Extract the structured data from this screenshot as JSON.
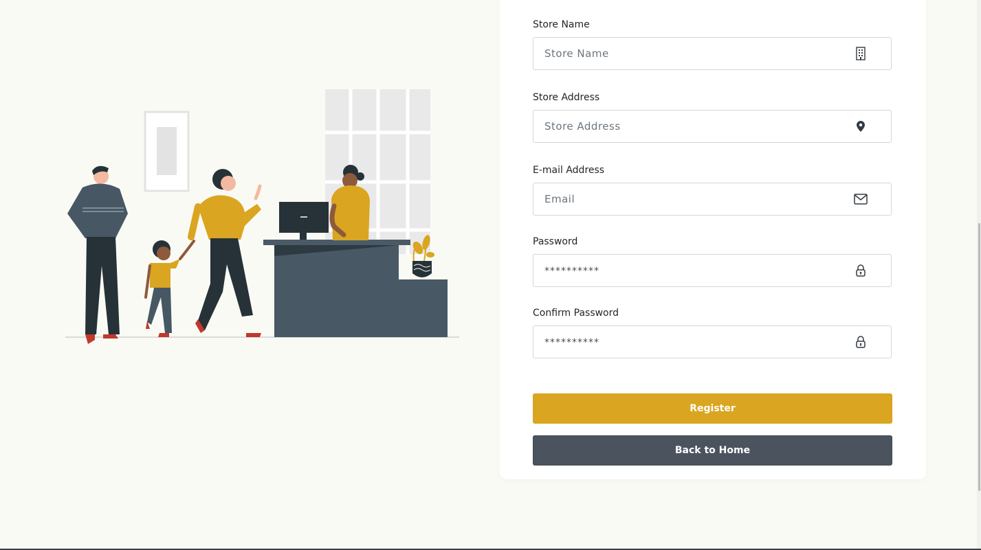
{
  "form": {
    "store_name": {
      "label": "Store Name",
      "placeholder": "Store Name",
      "icon": "building-icon"
    },
    "store_address": {
      "label": "Store Address",
      "placeholder": "Store Address",
      "icon": "map-pin-icon"
    },
    "email": {
      "label": "E-mail Address",
      "placeholder": "Email",
      "icon": "envelope-icon"
    },
    "password": {
      "label": "Password",
      "placeholder": "**********",
      "icon": "lock-icon"
    },
    "confirm_password": {
      "label": "Confirm Password",
      "placeholder": "**********",
      "icon": "lock-icon"
    }
  },
  "buttons": {
    "register": "Register",
    "back_home": "Back to Home"
  },
  "colors": {
    "accent": "#daa520",
    "secondary": "#4b545e",
    "background": "#fafaf5"
  }
}
